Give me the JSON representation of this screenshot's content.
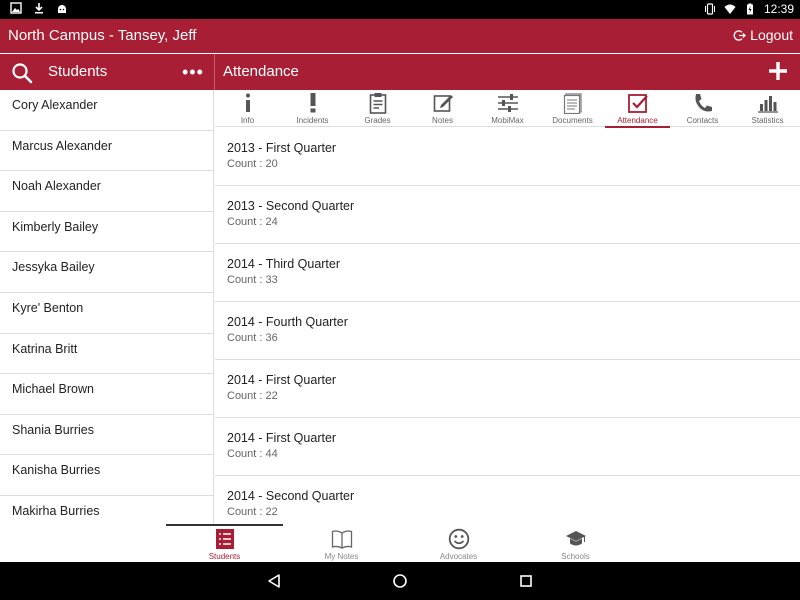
{
  "status_bar": {
    "time": "12:39",
    "icons_left": [
      "gallery-icon",
      "download-icon",
      "android-icon"
    ],
    "icons_right": [
      "vibrate-icon",
      "wifi-icon",
      "battery-icon"
    ]
  },
  "app_bar": {
    "title": "North Campus - Tansey, Jeff",
    "logout_label": "Logout"
  },
  "sub_bar": {
    "students_title": "Students",
    "attendance_title": "Attendance"
  },
  "students": [
    "Cory Alexander",
    "Marcus Alexander",
    "Noah Alexander",
    "Kimberly Bailey",
    "Jessyka Bailey",
    "Kyre' Benton",
    "Katrina Britt",
    "Michael Brown",
    "Shania Burries",
    "Kanisha Burries",
    "Makirha Burries"
  ],
  "tabs": [
    {
      "label": "Info",
      "icon": "info-icon"
    },
    {
      "label": "Incidents",
      "icon": "exclamation-icon"
    },
    {
      "label": "Grades",
      "icon": "clipboard-icon"
    },
    {
      "label": "Notes",
      "icon": "edit-note-icon"
    },
    {
      "label": "MobiMax",
      "icon": "sliders-icon"
    },
    {
      "label": "Documents",
      "icon": "documents-icon"
    },
    {
      "label": "Attendance",
      "icon": "checkbox-icon",
      "active": true
    },
    {
      "label": "Contacts",
      "icon": "phone-icon"
    },
    {
      "label": "Statistics",
      "icon": "bar-chart-icon"
    }
  ],
  "attendance": [
    {
      "name": "2013 - First Quarter",
      "count": "Count : 20"
    },
    {
      "name": "2013 - Second Quarter",
      "count": "Count : 24"
    },
    {
      "name": "2014 - Third Quarter",
      "count": "Count : 33"
    },
    {
      "name": "2014 - Fourth Quarter",
      "count": "Count : 36"
    },
    {
      "name": "2014 - First Quarter",
      "count": "Count : 22"
    },
    {
      "name": "2014 - First Quarter",
      "count": "Count : 44"
    },
    {
      "name": "2014 - Second Quarter",
      "count": "Count : 22"
    }
  ],
  "bottom_nav": [
    {
      "label": "Students",
      "icon": "list-icon",
      "active": true
    },
    {
      "label": "My Notes",
      "icon": "book-icon"
    },
    {
      "label": "Advocates",
      "icon": "smiley-icon"
    },
    {
      "label": "Schools",
      "icon": "graduation-cap-icon"
    }
  ],
  "colors": {
    "brand": "#a81e34",
    "divider": "#dcdcdc"
  }
}
